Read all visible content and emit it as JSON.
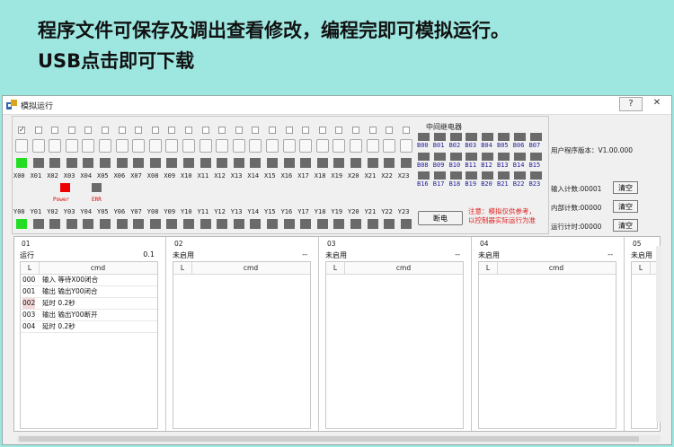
{
  "banner": {
    "line1": "程序文件可保存及调出查看修改，编程完即可模拟运行。",
    "line2": "USB点击即可下载"
  },
  "window": {
    "title": "模拟运行",
    "help": "?",
    "close": "✕"
  },
  "inputs": {
    "labels": [
      "X00",
      "X01",
      "X02",
      "X03",
      "X04",
      "X05",
      "X06",
      "X07",
      "X08",
      "X09",
      "X10",
      "X11",
      "X12",
      "X13",
      "X14",
      "X15",
      "X16",
      "X17",
      "X18",
      "X19",
      "X20",
      "X21",
      "X22",
      "X23"
    ],
    "checked": [
      true,
      false,
      false,
      false,
      false,
      false,
      false,
      false,
      false,
      false,
      false,
      false,
      false,
      false,
      false,
      false,
      false,
      false,
      false,
      false,
      false,
      false,
      false,
      false
    ],
    "leds": [
      true,
      false,
      false,
      false,
      false,
      false,
      false,
      false,
      false,
      false,
      false,
      false,
      false,
      false,
      false,
      false,
      false,
      false,
      false,
      false,
      false,
      false,
      false,
      false
    ]
  },
  "outputs": {
    "labels": [
      "Y00",
      "Y01",
      "Y02",
      "Y03",
      "Y04",
      "Y05",
      "Y06",
      "Y07",
      "Y08",
      "Y09",
      "Y10",
      "Y11",
      "Y12",
      "Y13",
      "Y14",
      "Y15",
      "Y16",
      "Y17",
      "Y18",
      "Y19",
      "Y20",
      "Y21",
      "Y22",
      "Y23"
    ],
    "leds": [
      true,
      false,
      false,
      false,
      false,
      false,
      false,
      false,
      false,
      false,
      false,
      false,
      false,
      false,
      false,
      false,
      false,
      false,
      false,
      false,
      false,
      false,
      false,
      false
    ]
  },
  "status": {
    "power_label": "Power",
    "err_label": "ERR",
    "power_color": "#ee0000",
    "err_color": "#6a6a6a"
  },
  "relay": {
    "title": "中间继电器",
    "labels": [
      "B00",
      "B01",
      "B02",
      "B03",
      "B04",
      "B05",
      "B06",
      "B07",
      "B08",
      "B09",
      "B10",
      "B11",
      "B12",
      "B13",
      "B14",
      "B15",
      "B16",
      "B17",
      "B18",
      "B19",
      "B20",
      "B21",
      "B22",
      "B23"
    ]
  },
  "controls": {
    "disconnect": "断电",
    "note_line1": "注意：模拟仅供参考，",
    "note_line2": "以控制器实际运行为准"
  },
  "info": {
    "version": "用户程序版本：V1.00.000",
    "input_count": "输入计数:00001",
    "internal_count": "内部计数:00000",
    "run_time": "运行计时:00000",
    "clear": "清空"
  },
  "panels": [
    {
      "num": "01",
      "status": "运行",
      "speed": "0.1",
      "col_l": "L",
      "col_cmd": "cmd",
      "rows": [
        {
          "n": "000",
          "t": "输入 等待X00闭合"
        },
        {
          "n": "001",
          "t": "输出 输出Y00闭合"
        },
        {
          "n": "002",
          "t": "延时 0.2秒"
        },
        {
          "n": "003",
          "t": "输出 输出Y00断开"
        },
        {
          "n": "004",
          "t": "延时 0.2秒"
        }
      ]
    },
    {
      "num": "02",
      "status": "未启用",
      "speed": "--",
      "col_l": "L",
      "col_cmd": "cmd",
      "rows": []
    },
    {
      "num": "03",
      "status": "未启用",
      "speed": "--",
      "col_l": "L",
      "col_cmd": "cmd",
      "rows": []
    },
    {
      "num": "04",
      "status": "未启用",
      "speed": "--",
      "col_l": "L",
      "col_cmd": "cmd",
      "rows": []
    },
    {
      "num": "05",
      "status": "未启用",
      "speed": "",
      "col_l": "L",
      "col_cmd": "",
      "rows": []
    }
  ],
  "colors": {
    "banner_bg": "#9ee7e1",
    "led_on": "#22dd22",
    "led_off": "#6a6a6a",
    "relay_text": "#22229a",
    "note_text": "#e02020"
  }
}
